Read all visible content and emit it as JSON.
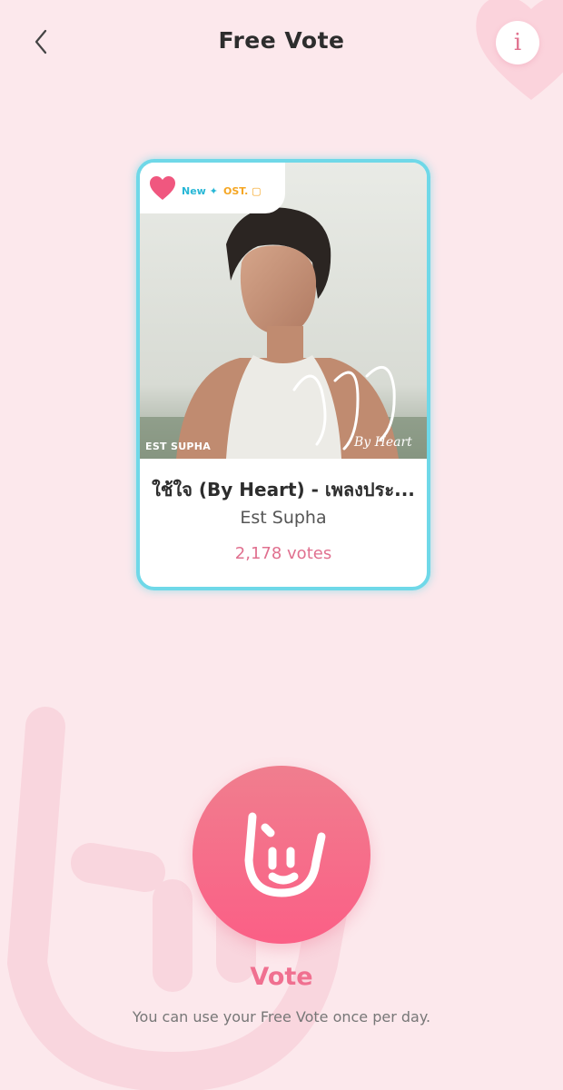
{
  "header": {
    "title": "Free Vote",
    "back_icon": "chevron-left-icon",
    "info_label": "i"
  },
  "card": {
    "badges": {
      "new": "New ✦",
      "ost": "OST. ▢"
    },
    "cover_watermark": "EST SUPHA",
    "song_title": "ใช้ใจ (By Heart) - เพลงประ...",
    "artist": "Est Supha",
    "votes": "2,178 votes"
  },
  "vote": {
    "label": "Vote",
    "hint": "You can use your Free Vote once per day.",
    "icon": "rock-hand-icon"
  },
  "colors": {
    "background": "#fce8ec",
    "accent": "#f07090",
    "card_border": "#6fd8e8",
    "vote_gradient_top": "#f07e8e",
    "vote_gradient_bottom": "#fb5f86"
  }
}
